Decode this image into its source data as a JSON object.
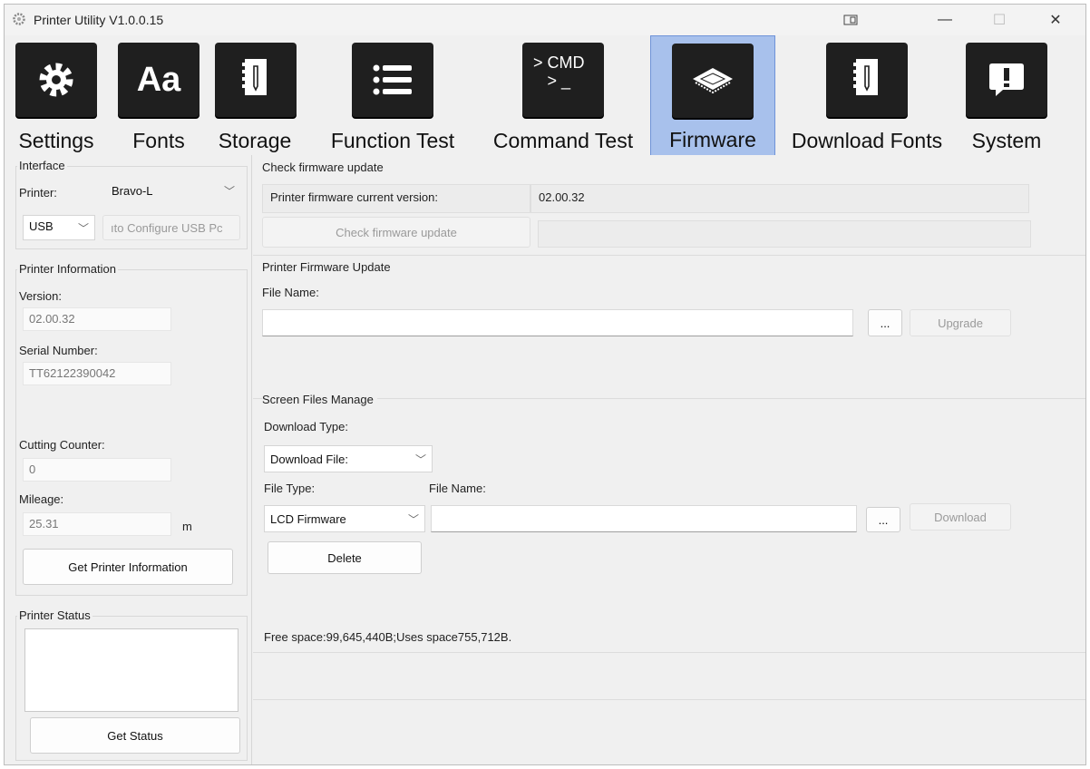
{
  "window": {
    "title": "Printer Utility  V1.0.0.15",
    "controls": {
      "snap": "◫",
      "minimize": "—",
      "maximize": "☐",
      "close": "✕"
    }
  },
  "toolbar": {
    "items": [
      {
        "label": "Settings",
        "icon": "gear-icon",
        "glyph": "⚙"
      },
      {
        "label": "Fonts",
        "icon": "fonts-icon",
        "glyph": "Aa"
      },
      {
        "label": "Storage",
        "icon": "storage-icon",
        "glyph": ""
      },
      {
        "label": "Function Test",
        "icon": "list-icon",
        "glyph": ""
      },
      {
        "label": "Command Test",
        "icon": "cmd-icon",
        "glyph": "> CMD\n> _"
      },
      {
        "label": "Firmware",
        "icon": "chip-icon",
        "glyph": ""
      },
      {
        "label": "Download Fonts",
        "icon": "download-fonts-icon",
        "glyph": ""
      },
      {
        "label": "System",
        "icon": "system-alert-icon",
        "glyph": "!"
      }
    ],
    "active": "Firmware",
    "active_color": "#a8c1ec"
  },
  "interface": {
    "title": "Interface",
    "printer_label": "Printer:",
    "printer_value": "Bravo-L",
    "port_value": "USB",
    "auto_config_label": "ıto Configure USB Pc"
  },
  "printer_info": {
    "title": "Printer Information",
    "version_label": "Version:",
    "version_value": "02.00.32",
    "serial_label": "Serial Number:",
    "serial_value": "TT62122390042",
    "cutting_label": "Cutting Counter:",
    "cutting_value": "0",
    "mileage_label": "Mileage:",
    "mileage_value": "25.31",
    "mileage_unit": "m",
    "get_info_button": "Get Printer Information"
  },
  "printer_status": {
    "title": "Printer Status",
    "get_status_button": "Get Status"
  },
  "check_update": {
    "title": "Check firmware update",
    "current_version_label": "Printer firmware current version:",
    "current_version_value": "02.00.32",
    "check_button": "Check firmware update"
  },
  "firmware_update": {
    "title": "Printer Firmware Update",
    "file_name_label": "File Name:",
    "browse_button": "...",
    "upgrade_button": "Upgrade"
  },
  "screen_files": {
    "title": "Screen Files Manage",
    "download_type_label": "Download Type:",
    "download_type_value": "Download File:",
    "file_type_label": "File Type:",
    "file_type_value": "LCD Firmware",
    "file_name_label": "File Name:",
    "browse_button": "...",
    "download_button": "Download",
    "delete_button": "Delete",
    "free_space_text": "Free space:99,645,440B;Uses space755,712B."
  }
}
